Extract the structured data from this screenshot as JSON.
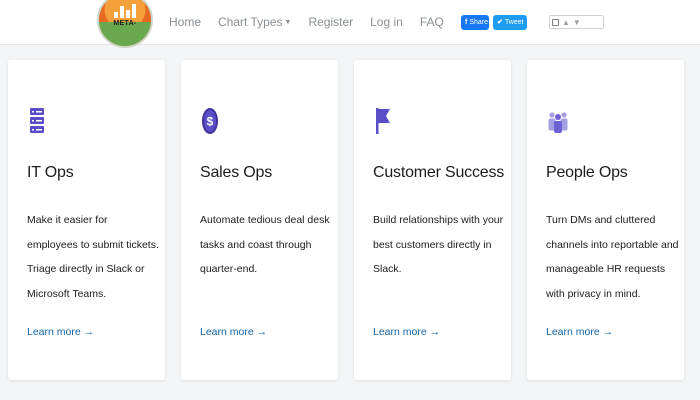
{
  "header": {
    "logo_text": "META-",
    "nav": [
      {
        "label": "Home"
      },
      {
        "label": "Chart Types",
        "has_caret": true
      },
      {
        "label": "Register"
      },
      {
        "label": "Log in"
      },
      {
        "label": "FAQ"
      }
    ],
    "share_label": "Share",
    "tweet_label": "Tweet",
    "colors": {
      "facebook": "#1877f2",
      "twitter": "#1d9bf0",
      "nav_text": "#8a8f96"
    }
  },
  "cards": [
    {
      "icon": "server-stack-icon",
      "title": "IT Ops",
      "description": "Make it easier for employees to submit tickets. Triage directly in Slack or Microsoft Teams.",
      "link": "Learn more →"
    },
    {
      "icon": "dollar-coin-icon",
      "title": "Sales Ops",
      "description": "Automate tedious deal desk tasks and coast through quarter-end.",
      "link": "Learn more →"
    },
    {
      "icon": "flag-icon",
      "title": "Customer Success",
      "description": "Build relationships with your best customers directly in Slack.",
      "link": "Learn more →"
    },
    {
      "icon": "people-group-icon",
      "title": "People Ops",
      "description": "Turn DMs and cluttered channels into reportable and manageable HR requests with privacy in mind.",
      "link": "Learn more →"
    }
  ],
  "accent_color": "#5b4fc9",
  "link_color": "#1264a3"
}
